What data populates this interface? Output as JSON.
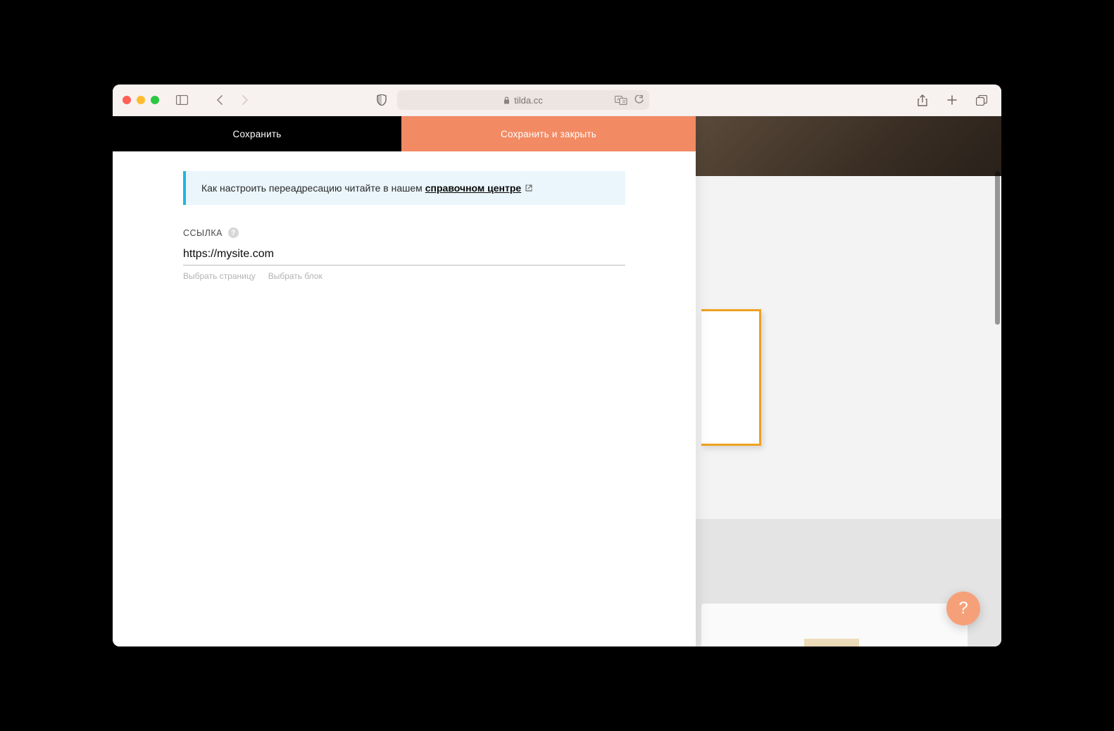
{
  "browser": {
    "url_host": "tilda.cc"
  },
  "panel": {
    "tabs": {
      "save": "Сохранить",
      "save_close": "Сохранить и закрыть"
    },
    "info": {
      "prefix": "Как настроить переадресацию читайте в нашем ",
      "link_text": "справочном центре"
    },
    "field": {
      "label": "ССЫЛКА",
      "value": "https://mysite.com",
      "placeholder": ""
    },
    "sub_links": {
      "select_page": "Выбрать страницу",
      "select_block": "Выбрать блок"
    }
  },
  "help_fab": {
    "glyph": "?"
  },
  "icons": {
    "help_q": "?"
  }
}
